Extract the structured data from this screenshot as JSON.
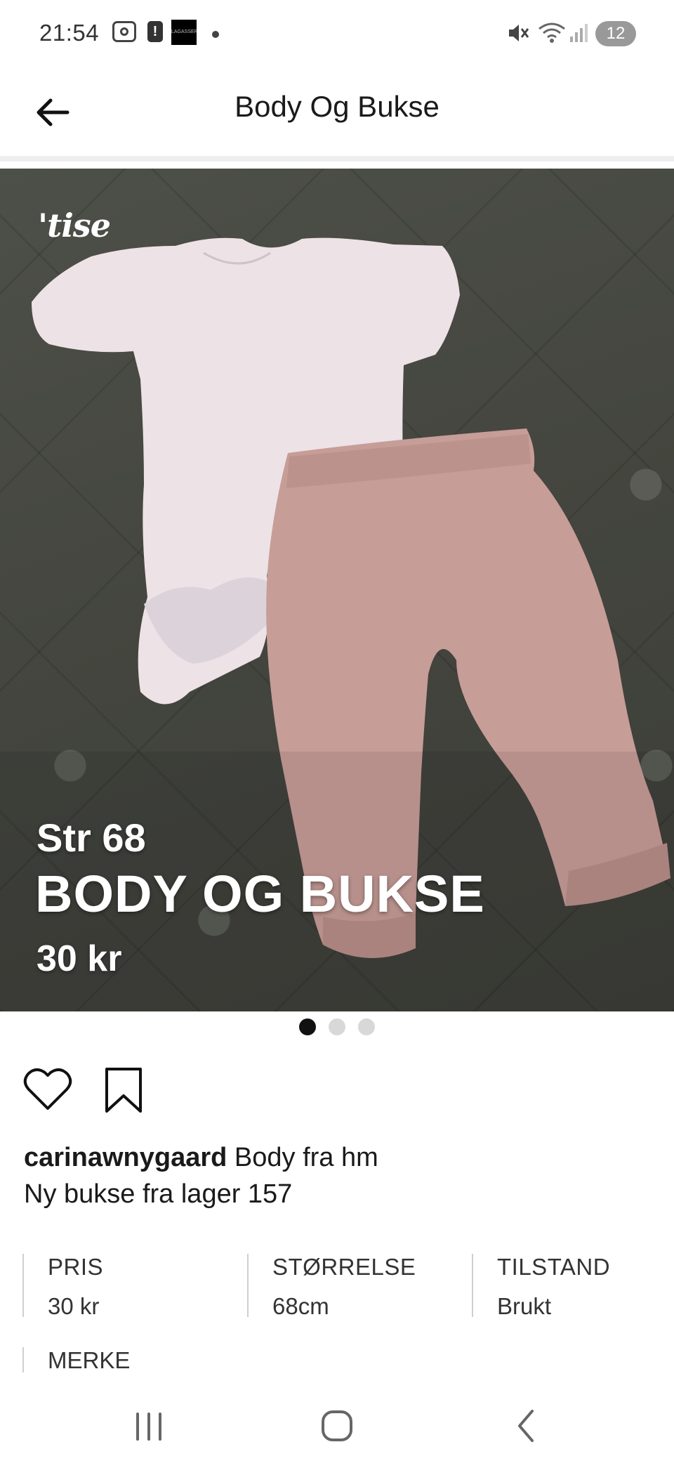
{
  "status_bar": {
    "time": "21:54",
    "app_icon_text": "LAGASSERT",
    "notification_count": "12",
    "icons": [
      "screen-record-icon",
      "alert-icon",
      "app-icon",
      "mute-icon",
      "wifi-icon",
      "signal-icon"
    ]
  },
  "app_bar": {
    "title": "Body Og Bukse",
    "back_icon": "arrow-left-icon"
  },
  "hero": {
    "watermark": "'tise",
    "size_text": "Str 68",
    "title_text": "BODY OG BUKSE",
    "price_text": "30 kr",
    "image_count": 3,
    "active_image": 1
  },
  "actions": {
    "like_icon": "heart-icon",
    "save_icon": "bookmark-icon"
  },
  "description": {
    "username": "carinawnygaard",
    "text_line1": "Body fra hm",
    "text_line2": "Ny bukse fra lager 157"
  },
  "attributes": [
    {
      "label": "PRIS",
      "value": "30 kr"
    },
    {
      "label": "STØRRELSE",
      "value": "68cm"
    },
    {
      "label": "TILSTAND",
      "value": "Brukt"
    }
  ],
  "brand_label": "MERKE",
  "colors": {
    "background": "#ffffff",
    "text": "#1a1a1a",
    "dot_active": "#111111",
    "dot_inactive": "#d8d8d8",
    "bodysuit": "#ede2e6",
    "pants": "#c79d97"
  },
  "nav_bar": {
    "icons": [
      "recent-apps-icon",
      "home-icon",
      "back-icon"
    ]
  }
}
